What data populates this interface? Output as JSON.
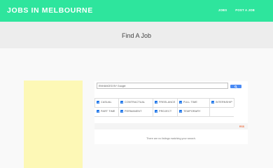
{
  "header": {
    "brand": "JOBS IN MELBOURNE",
    "nav": [
      "JOBS",
      "POST A JOB"
    ]
  },
  "page": {
    "title": "Find A Job"
  },
  "search": {
    "value": "ENHANCED BY Google"
  },
  "job_types": [
    {
      "label": "CASUAL",
      "checked": true
    },
    {
      "label": "CONTRACTUAL",
      "checked": true
    },
    {
      "label": "FREELANCE",
      "checked": true
    },
    {
      "label": "FULL TIME",
      "checked": true
    },
    {
      "label": "INTERNSHIP",
      "checked": true
    },
    {
      "label": "PART TIME",
      "checked": true
    },
    {
      "label": "PERMANENT",
      "checked": true
    },
    {
      "label": "PROJECT",
      "checked": true
    },
    {
      "label": "TEMPORARY",
      "checked": true
    }
  ],
  "results": {
    "rss_label": "RSS",
    "empty_message": "There are no listings matching your search."
  },
  "colors": {
    "header": "#2ee59d",
    "checkbox": "#1a73e8",
    "search_button": "#4a8af4",
    "rss": "#ee6b3b",
    "sidebar_ad": "#fdf8b6"
  }
}
